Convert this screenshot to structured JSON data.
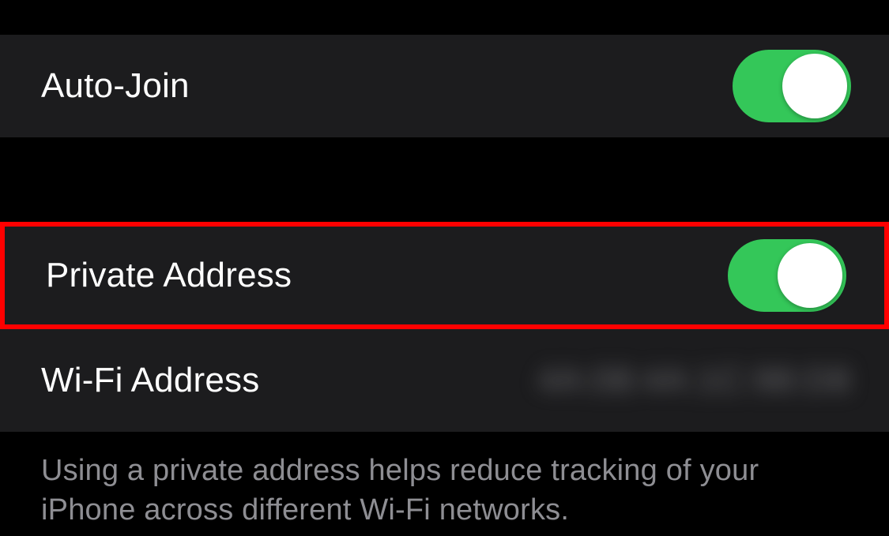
{
  "rows": {
    "autoJoin": {
      "label": "Auto-Join",
      "on": true
    },
    "privateAddress": {
      "label": "Private Address",
      "on": true
    },
    "wifiAddress": {
      "label": "Wi-Fi Address",
      "value": "4A:08:4A:1C:98:D8"
    }
  },
  "footer": "Using a private address helps reduce tracking of your iPhone across different Wi-Fi networks."
}
